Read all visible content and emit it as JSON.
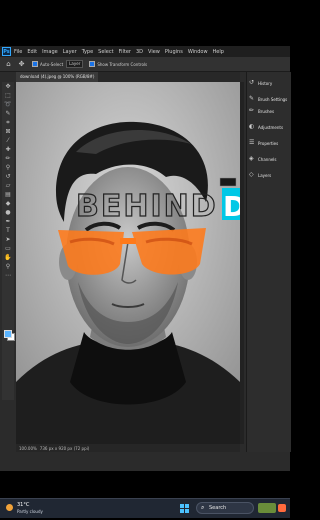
{
  "menu": {
    "items": [
      "File",
      "Edit",
      "Image",
      "Layer",
      "Type",
      "Select",
      "Filter",
      "3D",
      "View",
      "Plugins",
      "Window",
      "Help"
    ],
    "logo": "Ps"
  },
  "options": {
    "auto_select": "Auto-Select",
    "layer_select": "Layer",
    "show_transform": "Show Transform Controls"
  },
  "document": {
    "tab_title": "download (4).jpeg @ 100% (RGB/8#)",
    "zoom": "100.00%",
    "dimensions": "736 px x 920 px (72 ppi)",
    "overlay_text": "BEHIND",
    "glasses_color": "#ff7a1a",
    "accent_color": "#00c8e6"
  },
  "panels": {
    "items": [
      "History",
      "Brush Settings",
      "Brushes",
      "Adjustments",
      "Properties",
      "Channels",
      "Layers"
    ]
  },
  "tools": {
    "icons": [
      "move-icon",
      "marquee-icon",
      "lasso-icon",
      "quick-select-icon",
      "crop-icon",
      "frame-icon",
      "eyedropper-icon",
      "spot-heal-icon",
      "brush-icon",
      "stamp-icon",
      "history-brush-icon",
      "eraser-icon",
      "gradient-icon",
      "blur-icon",
      "dodge-icon",
      "pen-icon",
      "type-icon",
      "path-select-icon",
      "rectangle-icon",
      "hand-icon",
      "zoom-icon",
      "more-icon"
    ]
  },
  "taskbar": {
    "temperature": "31°C",
    "weather": "Partly cloudy",
    "search_label": "Search"
  }
}
